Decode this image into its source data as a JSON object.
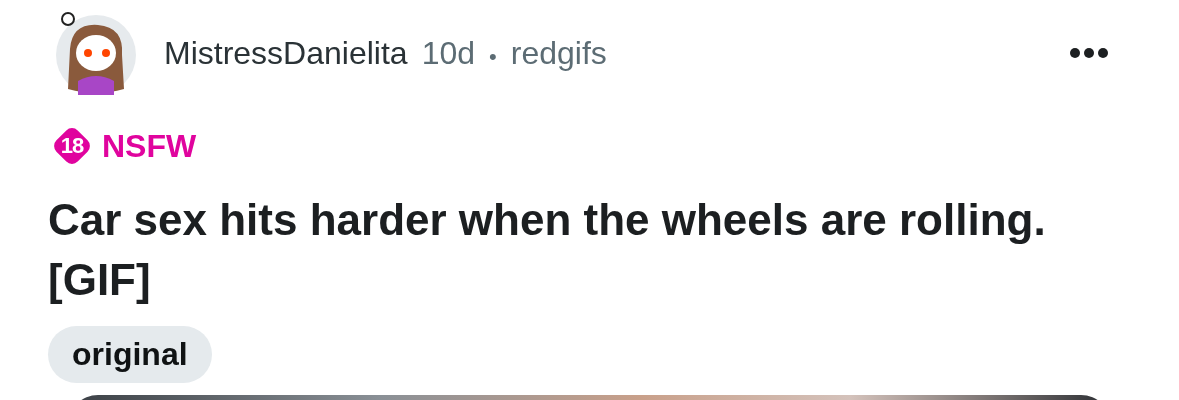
{
  "post": {
    "author": "MistressDanielita",
    "age": "10d",
    "separator": "•",
    "source": "redgifs",
    "nsfw": {
      "age_mark": "18",
      "label": "NSFW"
    },
    "title": "Car sex hits harder when the wheels are rolling. [GIF]",
    "flair": "original"
  }
}
